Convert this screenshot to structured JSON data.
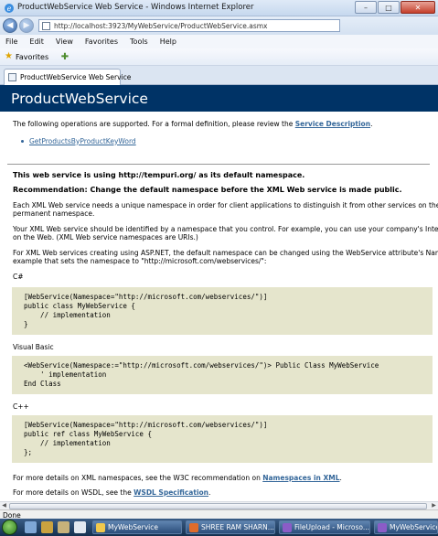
{
  "window": {
    "title": "ProductWebService Web Service - Windows Internet Explorer",
    "url": "http://localhost:3923/MyWebService/ProductWebService.asmx"
  },
  "menu": [
    "File",
    "Edit",
    "View",
    "Favorites",
    "Tools",
    "Help"
  ],
  "favorites_label": "Favorites",
  "tab_label": "ProductWebService Web Service",
  "page": {
    "heading": "ProductWebService",
    "intro": "The following operations are supported. For a formal definition, please review the",
    "intro_link": "Service Description",
    "intro_end": ".",
    "operation": "GetProductsByProductKeyWord",
    "namespace_msg": "This web service is using http://tempuri.org/ as its default namespace.",
    "recommendation": "Recommendation: Change the default namespace before the XML Web service is made public.",
    "para1_line1": "Each XML Web service needs a unique namespace in order for client applications to distinguish it from other services on the W",
    "para1_line2": "permanent namespace.",
    "para2_line1": "Your XML Web service should be identified by a namespace that you control. For example, you can use your company's Intern",
    "para2_line2": "on the Web. (XML Web service namespaces are URIs.)",
    "para3_line1": "For XML Web services creating using ASP.NET, the default namespace can be changed using the WebService attribute's Name",
    "para3_line2": "example that sets the namespace to \"http://microsoft.com/webservices/\":",
    "csharp_label": "C#",
    "csharp_code": "[WebService(Namespace=\"http://microsoft.com/webservices/\")]\npublic class MyWebService {\n    // implementation\n}",
    "vb_label": "Visual Basic",
    "vb_code": "<WebService(Namespace:=\"http://microsoft.com/webservices/\")> Public Class MyWebService\n    ' implementation\nEnd Class",
    "cpp_label": "C++",
    "cpp_code": "[WebService(Namespace=\"http://microsoft.com/webservices/\")]\npublic ref class MyWebService {\n    // implementation\n};",
    "xml_ns_text": "For more details on XML namespaces, see the W3C recommendation on",
    "xml_ns_link": "Namespaces in XML",
    "xml_ns_end": ".",
    "wsdl_text": "For more details on WSDL, see the",
    "wsdl_link": "WSDL Specification",
    "wsdl_end": "."
  },
  "status": "Done",
  "taskbar": {
    "tasks": [
      "MyWebService",
      "SHREE RAM SHARN...",
      "FileUpload - Microso...",
      "MyWebService"
    ]
  }
}
